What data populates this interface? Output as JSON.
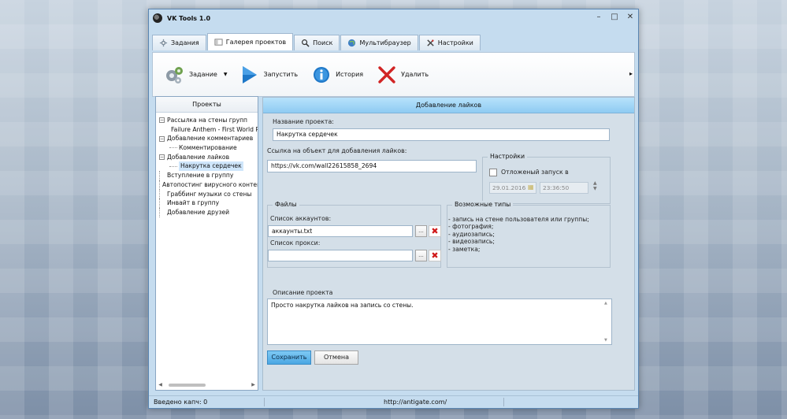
{
  "window": {
    "title": "VK Tools  1.0"
  },
  "window_buttons": {
    "minimize": "–",
    "maximize": "□",
    "close": "✕"
  },
  "tabs": [
    {
      "label": "Задания",
      "icon": "tasks-icon"
    },
    {
      "label": "Галерея проектов",
      "icon": "gallery-icon"
    },
    {
      "label": "Поиск",
      "icon": "search-icon"
    },
    {
      "label": "Мультибраузер",
      "icon": "globe-icon"
    },
    {
      "label": "Настройки",
      "icon": "settings-icon"
    }
  ],
  "active_tab": "Галерея проектов",
  "toolbar": {
    "task_label": "Задание",
    "run_label": "Запустить",
    "history_label": "История",
    "delete_label": "Удалить",
    "more_arrow": "▸"
  },
  "projects": {
    "header": "Проекты",
    "tree": [
      {
        "label": "Рассылка на стены групп",
        "toggle": "−",
        "children": [
          "Failure Anthem - First World P"
        ]
      },
      {
        "label": "Добавление комментариев",
        "toggle": "−",
        "children": [
          "Комментирование"
        ]
      },
      {
        "label": "Добавление лайков",
        "toggle": "−",
        "children": [
          "Накрутка сердечек"
        ]
      },
      {
        "label": "Вступление в группу"
      },
      {
        "label": "Автопостинг вирусного контен"
      },
      {
        "label": "Граббинг музыки со стены"
      },
      {
        "label": "Инвайт в группу"
      },
      {
        "label": "Добавление друзей"
      }
    ],
    "selected": "Накрутка сердечек"
  },
  "form": {
    "header": "Добавление лайков",
    "name_label": "Название проекта:",
    "name_value": "Накрутка сердечек",
    "link_label": "Ссылка на объект для добавления лайков:",
    "link_value": "https://vk.com/wall22615858_2694",
    "settings": {
      "title": "Настройки",
      "delayed_label": "Отложеный запуск в",
      "date": "29.01.2016",
      "time": "23:36:50"
    },
    "files": {
      "title": "Файлы",
      "accounts_label": "Список аккаунтов:",
      "accounts_value": "аккаунты.txt",
      "proxy_label": "Список прокси:",
      "proxy_value": "",
      "browse": "...",
      "delete": "✖"
    },
    "types": {
      "title": "Возможные типы",
      "items": [
        "- запись на стене пользователя или группы;",
        "- фотография;",
        "- аудиозапись;",
        "- видеозапись;",
        "- заметка;"
      ]
    },
    "description_label": "Описание проекта",
    "description_value": "Просто накрутка лайков на запись со стены.",
    "save_label": "Сохранить",
    "cancel_label": "Отмена"
  },
  "status": {
    "captcha": "Введено капч: 0",
    "url": "http://antigate.com/"
  }
}
